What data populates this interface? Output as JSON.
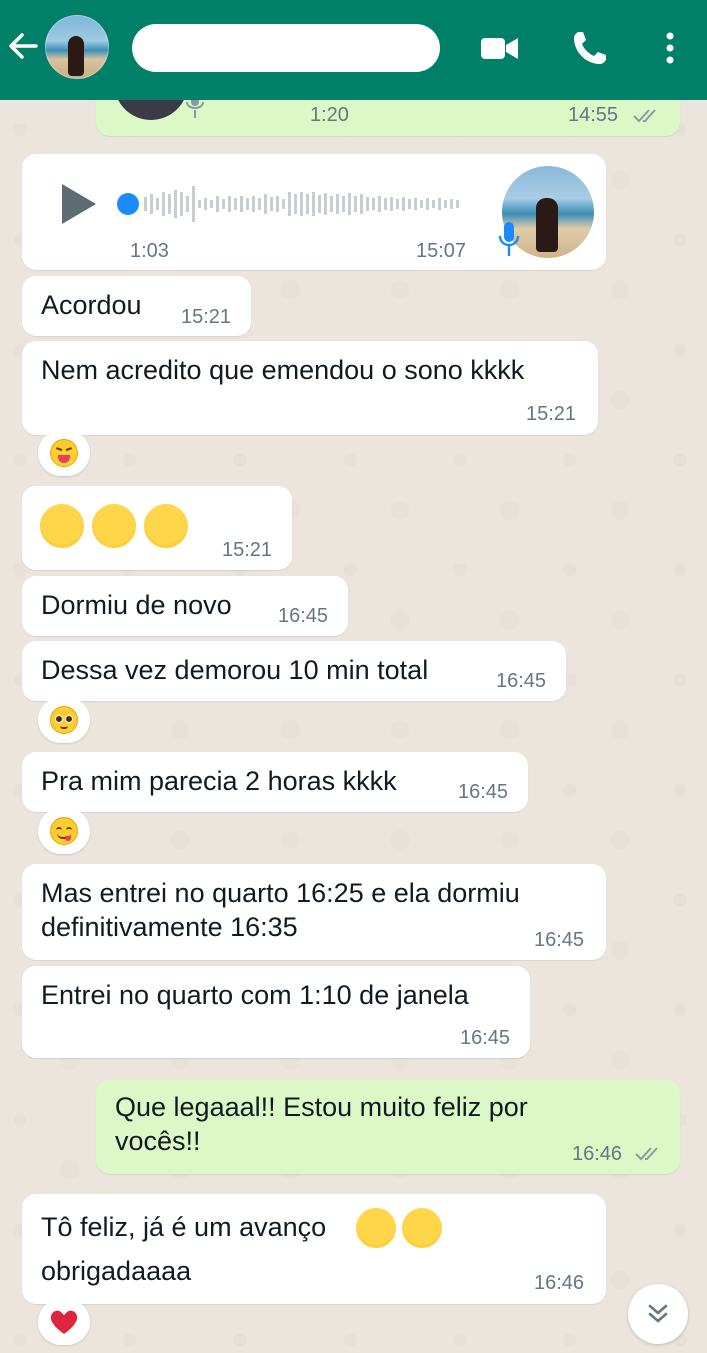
{
  "header": {
    "contact_name": "",
    "icons": [
      "back-arrow-icon",
      "video-call-icon",
      "phone-icon",
      "more-vert-icon"
    ],
    "bg_color": "#008069"
  },
  "messages": {
    "top_audio": {
      "duration": "1:20",
      "time": "14:55"
    },
    "audio": {
      "duration": "1:03",
      "time": "15:07"
    },
    "m1": {
      "text": "Acordou",
      "time": "15:21"
    },
    "m2": {
      "text": "Nem acredito que emendou o sono kkkk",
      "time": "15:21",
      "reaction": "😝"
    },
    "m3": {
      "text": "🥰🥰🥰",
      "time": "15:21"
    },
    "m4": {
      "text": "Dormiu de novo",
      "time": "16:45"
    },
    "m5": {
      "text": "Dessa vez demorou 10 min total",
      "time": "16:45",
      "reaction": "🥹"
    },
    "m6": {
      "text": "Pra mim parecia 2 horas kkkk",
      "time": "16:45",
      "reaction": "😋"
    },
    "m7": {
      "line1": "Mas entrei no quarto 16:25 e ela dormiu",
      "line2": "definitivamente 16:35",
      "time": "16:45"
    },
    "m8": {
      "text": "Entrei no quarto com 1:10 de janela",
      "time": "16:45"
    },
    "m9": {
      "line1": "Que legaaal!! Estou muito feliz por",
      "line2": "vocês!!",
      "time": "16:46"
    },
    "m10": {
      "line1": "Tô feliz, já é um avanço",
      "line2": "obrigadaaaa",
      "time": "16:46",
      "reaction": "❤️"
    }
  },
  "colors": {
    "incoming": "#ffffff",
    "outgoing": "#dcf8c6",
    "chat_bg": "#ece5dd",
    "audio_accent": "#1a8cff"
  }
}
